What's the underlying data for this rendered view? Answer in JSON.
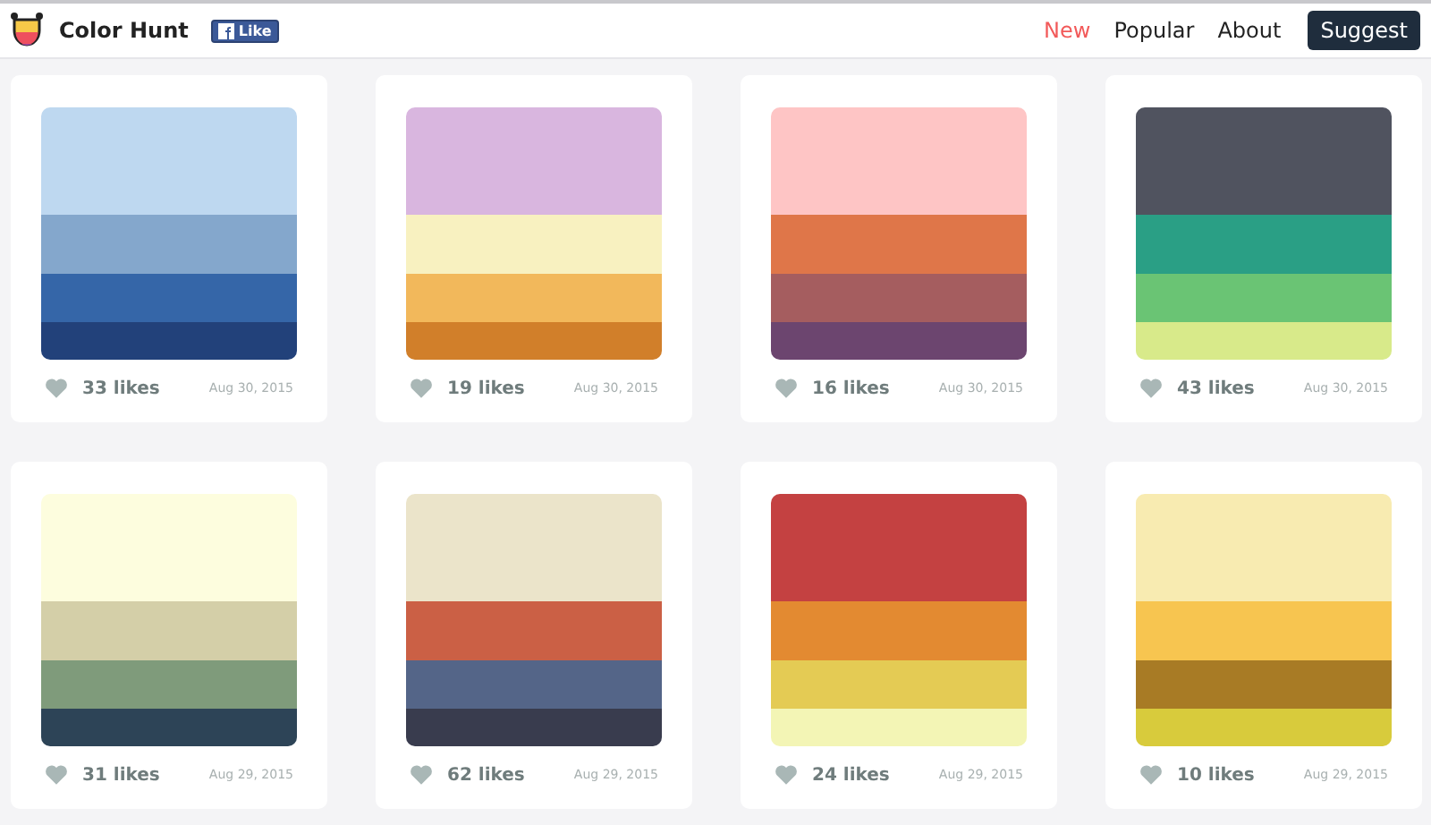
{
  "header": {
    "brand": "Color Hunt",
    "fb_like": "Like",
    "nav": [
      {
        "label": "New",
        "selected": true
      },
      {
        "label": "Popular",
        "selected": false
      },
      {
        "label": "About",
        "selected": false
      }
    ],
    "suggest": "Suggest"
  },
  "palettes": [
    {
      "swatches": [
        {
          "color": "#bed8f0"
        },
        {
          "color": "#84a7cc"
        },
        {
          "color": "#3566a8"
        },
        {
          "color": "#22417a"
        }
      ],
      "likes": "33 likes",
      "date": "Aug 30, 2015"
    },
    {
      "swatches": [
        {
          "color": "#d9b6df"
        },
        {
          "color": "#f8f1c0"
        },
        {
          "color": "#f2b85b"
        },
        {
          "color": "#d17f2a"
        }
      ],
      "likes": "19 likes",
      "date": "Aug 30, 2015"
    },
    {
      "swatches": [
        {
          "color": "#fec5c5"
        },
        {
          "color": "#df7649"
        },
        {
          "color": "#a55d5f"
        },
        {
          "color": "#6c456f"
        }
      ],
      "likes": "16 likes",
      "date": "Aug 30, 2015"
    },
    {
      "swatches": [
        {
          "color": "#50535f"
        },
        {
          "color": "#2a9f85"
        },
        {
          "color": "#6ac474"
        },
        {
          "color": "#d8ea8a"
        }
      ],
      "likes": "43 likes",
      "date": "Aug 30, 2015"
    },
    {
      "swatches": [
        {
          "color": "#fdfdde"
        },
        {
          "color": "#d4cfa8"
        },
        {
          "color": "#7f9b7b"
        },
        {
          "color": "#2d4457"
        }
      ],
      "likes": "31 likes",
      "date": "Aug 29, 2015"
    },
    {
      "swatches": [
        {
          "color": "#ebe4ca"
        },
        {
          "color": "#cb6045"
        },
        {
          "color": "#546588"
        },
        {
          "color": "#393c4e"
        }
      ],
      "likes": "62 likes",
      "date": "Aug 29, 2015"
    },
    {
      "swatches": [
        {
          "color": "#c44141"
        },
        {
          "color": "#e38a31"
        },
        {
          "color": "#e4cb54"
        },
        {
          "color": "#f3f5b5"
        }
      ],
      "likes": "24 likes",
      "date": "Aug 29, 2015"
    },
    {
      "swatches": [
        {
          "color": "#f8ebb1"
        },
        {
          "color": "#f7c550"
        },
        {
          "color": "#a87b25"
        },
        {
          "color": "#d8cb3c"
        }
      ],
      "likes": "10 likes",
      "date": "Aug 29, 2015"
    }
  ]
}
